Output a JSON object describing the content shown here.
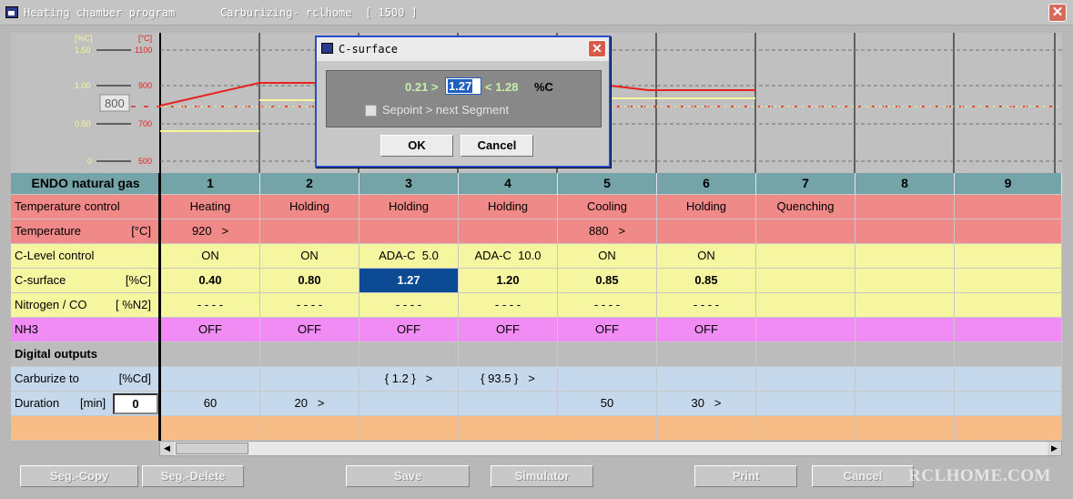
{
  "window": {
    "title_left": "Heating chamber program",
    "title_right": "Carburizing- rclhome  [ 1500 ]",
    "close_glyph": "✕"
  },
  "chart": {
    "left_axis_unit": "[%C]",
    "right_axis_unit": "[°C]",
    "c_ticks": [
      "1.50",
      "1.00",
      "0.50",
      "0"
    ],
    "t_ticks": [
      "1100",
      "900",
      "700",
      "500"
    ],
    "setpoint_box": "800",
    "colors": {
      "temperature": "#e82020",
      "carbon": "#f6f69a",
      "left_axis": "#f6f69a",
      "right_axis": "#e82020"
    }
  },
  "grid": {
    "header": {
      "label": "ENDO natural gas",
      "segments": [
        "1",
        "2",
        "3",
        "4",
        "5",
        "6",
        "7",
        "8",
        "9"
      ]
    },
    "rows": [
      {
        "label": "Temperature control",
        "unit": "",
        "cells": [
          "Heating",
          "Holding",
          "Holding",
          "Holding",
          "Cooling",
          "Holding",
          "Quenching",
          "",
          ""
        ]
      },
      {
        "label": "Temperature",
        "unit": "[°C]",
        "cells": [
          "920   >",
          "",
          "",
          "",
          "880   >",
          "",
          "",
          "",
          ""
        ]
      },
      {
        "label": "C-Level control",
        "unit": "",
        "cells": [
          "ON",
          "ON",
          "ADA-C  5.0",
          "ADA-C  10.0",
          "ON",
          "ON",
          "",
          "",
          ""
        ]
      },
      {
        "label": "C-surface",
        "unit": "[%C]",
        "cells": [
          "0.40",
          "0.80",
          "1.27",
          "1.20",
          "0.85",
          "0.85",
          "",
          "",
          ""
        ]
      },
      {
        "label": "Nitrogen / CO",
        "unit": "[ %N2]",
        "cells": [
          "- - - -",
          "- - - -",
          "- - - -",
          "- - - -",
          "- - - -",
          "- - - -",
          "",
          "",
          ""
        ]
      },
      {
        "label": "NH3",
        "unit": "",
        "cells": [
          "OFF",
          "OFF",
          "OFF",
          "OFF",
          "OFF",
          "OFF",
          "",
          "",
          ""
        ]
      },
      {
        "label": "Digital outputs",
        "unit": "",
        "cells": [
          "",
          "",
          "",
          "",
          "",
          "",
          "",
          "",
          ""
        ]
      },
      {
        "label": "Carburize to",
        "unit": "[%Cd]",
        "cells": [
          "",
          "",
          "{ 1.2 }   >",
          "{ 93.5 }   >",
          "",
          "",
          "",
          "",
          ""
        ]
      },
      {
        "label": "Duration",
        "unit": "[min]",
        "value": "0",
        "cells": [
          "60",
          "20   >",
          "",
          "",
          "50",
          "30   >",
          "",
          "",
          ""
        ]
      },
      {
        "label": "",
        "unit": "",
        "cells": [
          "",
          "",
          "",
          "",
          "",
          "",
          "",
          "",
          ""
        ]
      }
    ]
  },
  "scrollbar": {
    "left_arrow": "◀",
    "right_arrow": "▶"
  },
  "buttons": {
    "seg_copy": "Seg.-Copy",
    "seg_delete": "Seg.-Delete",
    "save": "Save",
    "simulator": "Simulator",
    "print": "Print",
    "cancel": "Cancel"
  },
  "watermark": "RCLHOME.COM",
  "dialog": {
    "title": "C-surface",
    "close_glyph": "✕",
    "low": "0.21 >",
    "value": "1.27",
    "high": "< 1.28",
    "unit": "%C",
    "checkbox_label": "Sepoint > next Segment",
    "ok": "OK",
    "cancel": "Cancel"
  }
}
